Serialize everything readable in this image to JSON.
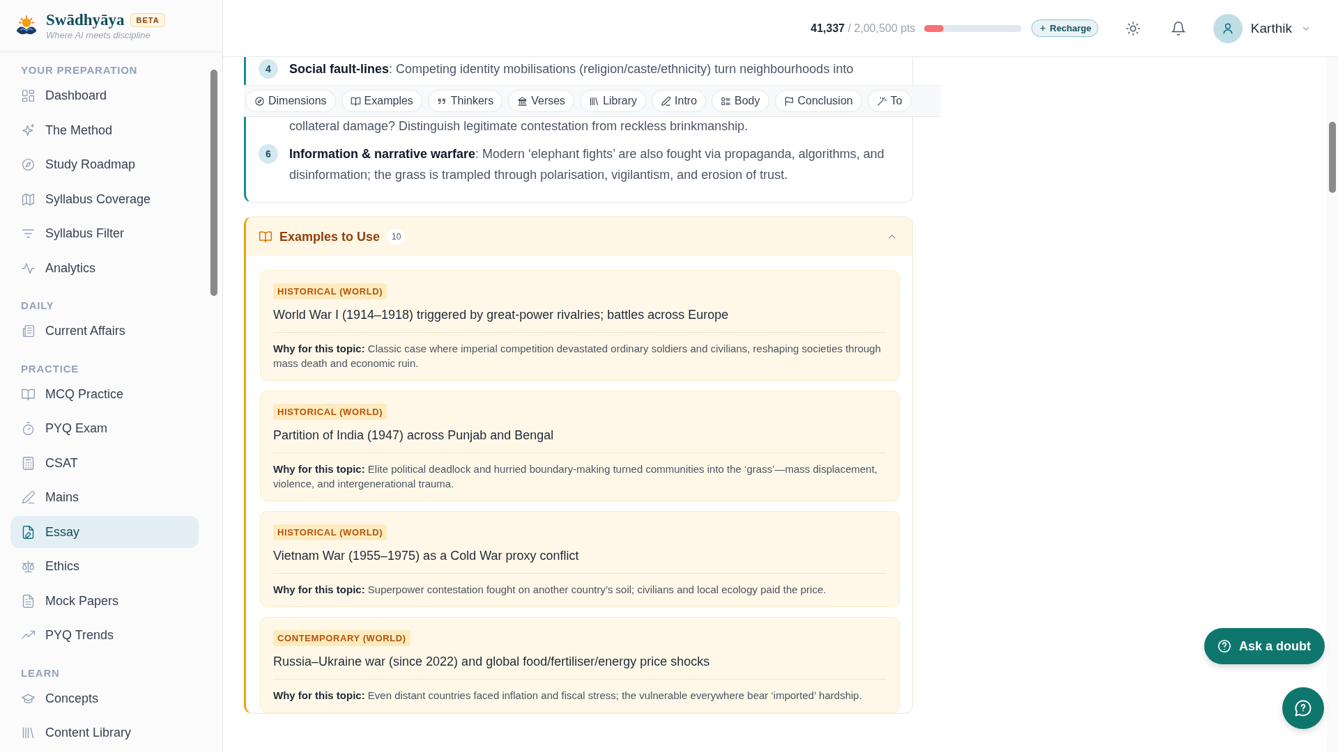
{
  "brand": {
    "name": "Swādhyāya",
    "badge": "BETA",
    "tagline": "Where AI meets discipline"
  },
  "sidebar": {
    "sections": [
      {
        "title": "YOUR PREPARATION",
        "items": [
          {
            "label": "Dashboard",
            "selected": false
          },
          {
            "label": "The Method",
            "selected": false
          },
          {
            "label": "Study Roadmap",
            "selected": false
          },
          {
            "label": "Syllabus Coverage",
            "selected": false
          },
          {
            "label": "Syllabus Filter",
            "selected": false
          },
          {
            "label": "Analytics",
            "selected": false
          }
        ]
      },
      {
        "title": "DAILY",
        "items": [
          {
            "label": "Current Affairs",
            "selected": false
          }
        ]
      },
      {
        "title": "PRACTICE",
        "items": [
          {
            "label": "MCQ Practice",
            "selected": false
          },
          {
            "label": "PYQ Exam",
            "selected": false
          },
          {
            "label": "CSAT",
            "selected": false
          },
          {
            "label": "Mains",
            "selected": false
          },
          {
            "label": "Essay",
            "selected": true
          },
          {
            "label": "Ethics",
            "selected": false
          },
          {
            "label": "Mock Papers",
            "selected": false
          },
          {
            "label": "PYQ Trends",
            "selected": false
          }
        ]
      },
      {
        "title": "LEARN",
        "items": [
          {
            "label": "Concepts",
            "selected": false
          },
          {
            "label": "Content Library",
            "selected": false
          }
        ]
      }
    ]
  },
  "header": {
    "points": "41,337",
    "points_total": "/ 2,00,500 pts",
    "level": 0.2,
    "recharge": "Recharge",
    "user": "Karthik"
  },
  "dimensions": {
    "items": [
      {
        "number": "4",
        "text": "**Social fault-lines**: Competing identity mobilisations (religion/caste/ethnicity) turn neighbourhoods into"
      },
      {
        "text": "collateral damage? Distinguish legitimate contestation from reckless brinkmanship."
      },
      {
        "number": "6",
        "text": "**Information & narrative warfare**: Modern ‘elephant fights’ are also fought via propaganda, algorithms, and disinformation; the grass is trampled through polarisation, vigilantism, and erosion of trust."
      }
    ]
  },
  "toolbar": {
    "tabs": [
      {
        "label": "Dimensions"
      },
      {
        "label": "Examples"
      },
      {
        "label": "Thinkers"
      },
      {
        "label": "Verses"
      },
      {
        "label": "Library"
      },
      {
        "label": "Intro"
      },
      {
        "label": "Body"
      },
      {
        "label": "Conclusion"
      },
      {
        "label": "To"
      }
    ]
  },
  "examples": {
    "title": "Examples to Use",
    "count": "10",
    "expanded": true,
    "cards": [
      {
        "tag": "HISTORICAL (WORLD)",
        "title": "World War I (1914–1918) triggered by great-power rivalries; battles across Europe",
        "why": "**Why for this topic:** Classic case where imperial competition devastated ordinary soldiers and civilians, reshaping societies through mass death and economic ruin."
      },
      {
        "tag": "HISTORICAL (WORLD)",
        "title": "Partition of India (1947) across Punjab and Bengal",
        "why": "**Why for this topic:** Elite political deadlock and hurried boundary-making turned communities into the ‘grass’—mass displacement, violence, and intergenerational trauma."
      },
      {
        "tag": "HISTORICAL (WORLD)",
        "title": "Vietnam War (1955–1975) as a Cold War proxy conflict",
        "why": "**Why for this topic:** Superpower contestation fought on another country’s soil; civilians and local ecology paid the price."
      },
      {
        "tag": "CONTEMPORARY (WORLD)",
        "title": "Russia–Ukraine war (since 2022) and global food/fertiliser/energy price shocks",
        "why": "**Why for this topic:** Even distant countries faced inflation and fiscal stress; the vulnerable everywhere bear ‘imported’ hardship."
      }
    ]
  },
  "ask_button": "Ask a doubt"
}
